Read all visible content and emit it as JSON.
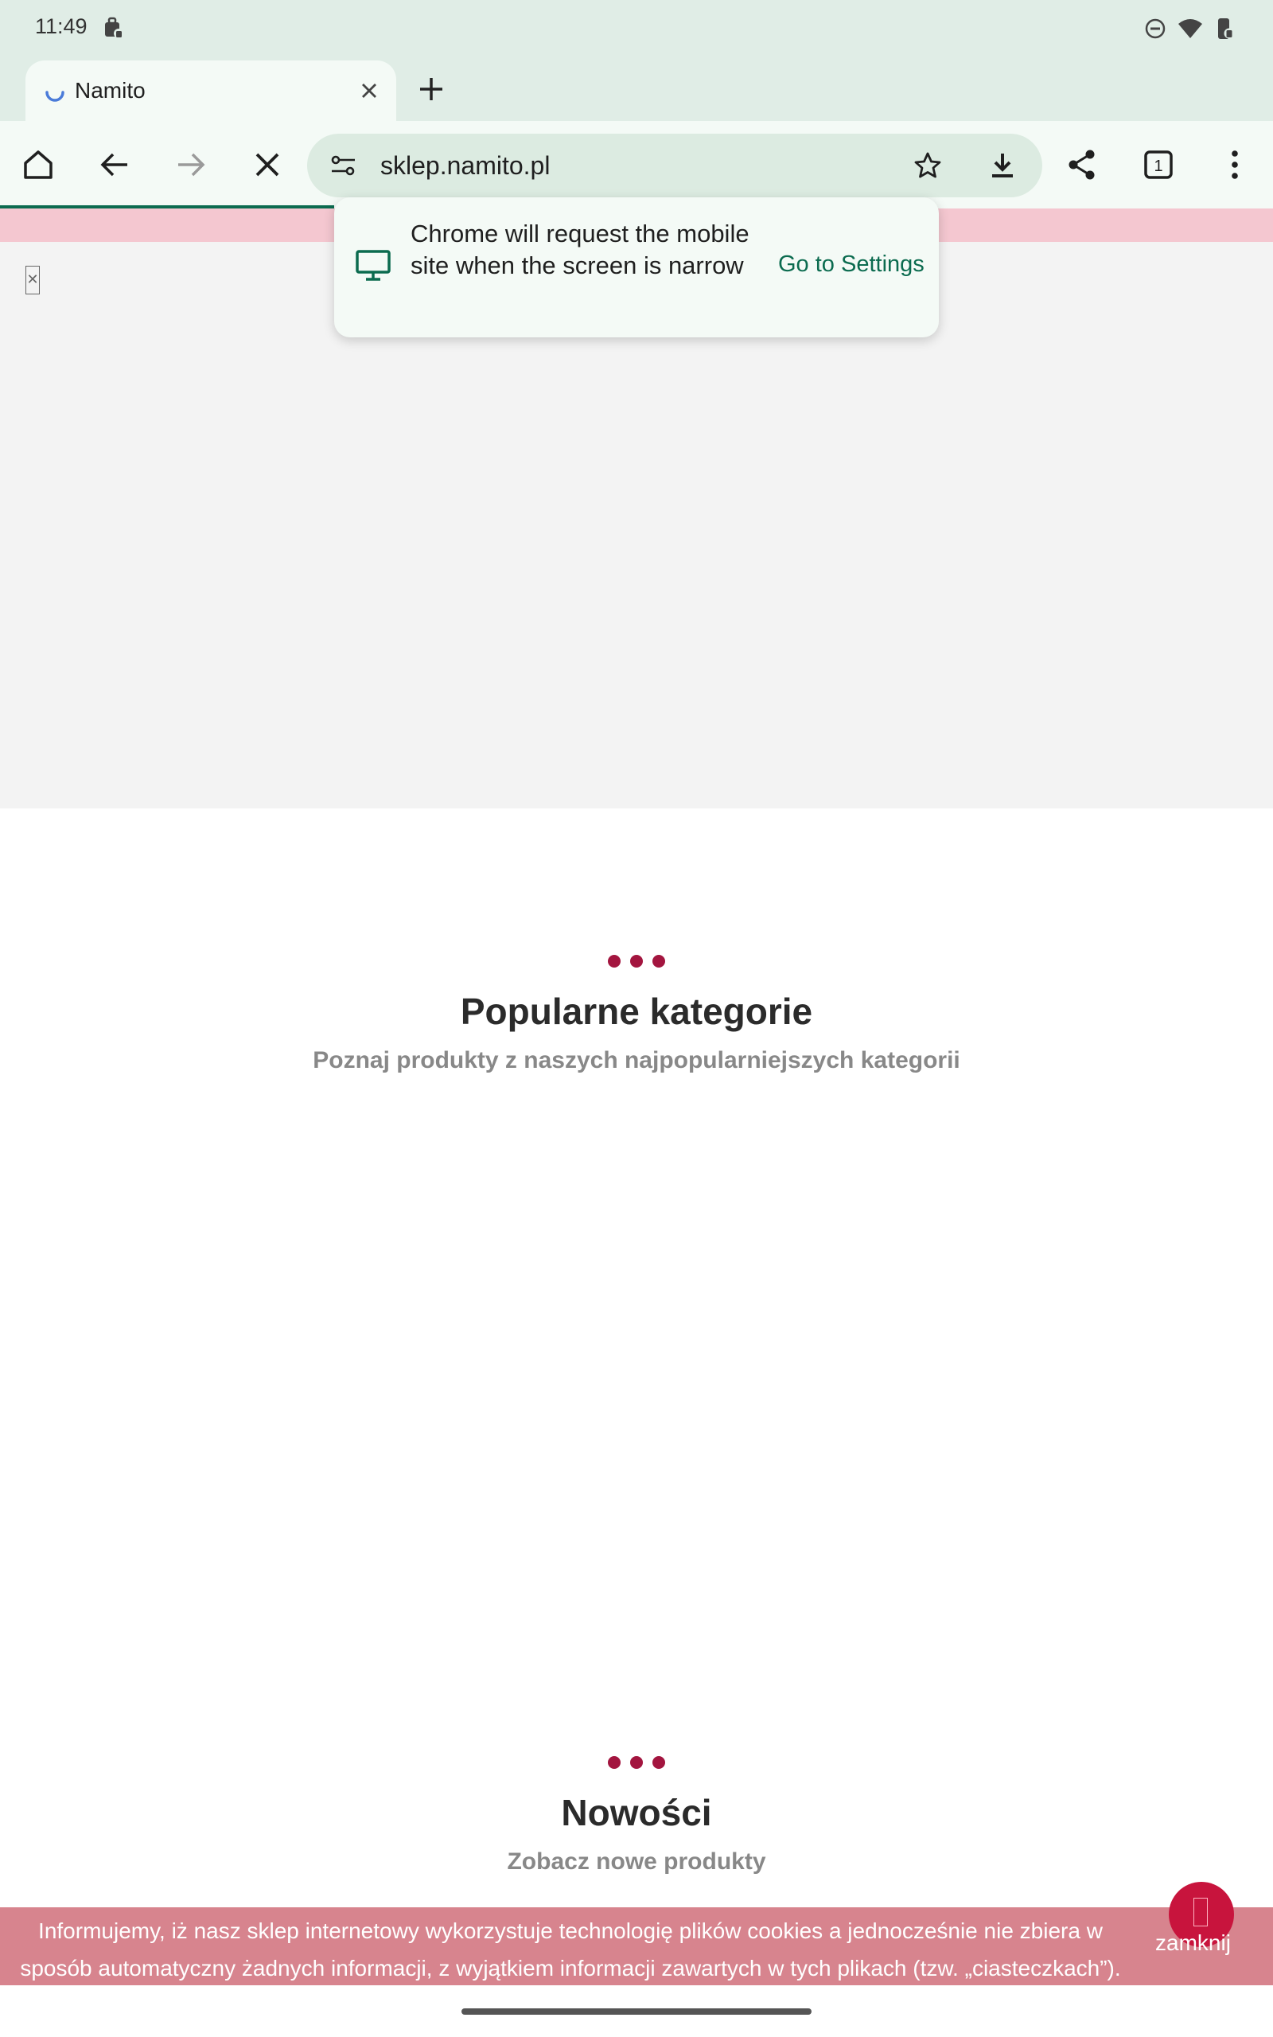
{
  "status_bar": {
    "time": "11:49",
    "icons": [
      "work-profile-icon",
      "do-not-disturb-icon",
      "wifi-icon",
      "battery-icon"
    ]
  },
  "tabs": [
    {
      "title": "Namito",
      "loading": true
    }
  ],
  "toolbar": {
    "url": "sklep.namito.pl",
    "tab_count": "1",
    "accent_color": "#0b6b4f"
  },
  "popup": {
    "message": "Chrome will request the mobile site when the screen is narrow",
    "action": "Go to Settings"
  },
  "page": {
    "sections": [
      {
        "title": "Popularne kategorie",
        "subtitle": "Poznaj produkty z naszych najpopularniejszych kategorii"
      },
      {
        "title": "Nowości",
        "subtitle": "Zobacz nowe produkty"
      }
    ],
    "brand_color": "#a3153f"
  },
  "cookie_banner": {
    "text": "Informujemy, iż nasz sklep internetowy wykorzystuje technologię plików cookies a jednocześnie nie zbiera w sposób automatyczny żadnych informacji, z wyjątkiem informacji zawartych w tych plikach (tzw. „ciasteczkach”).",
    "close_label": "zamknij"
  }
}
